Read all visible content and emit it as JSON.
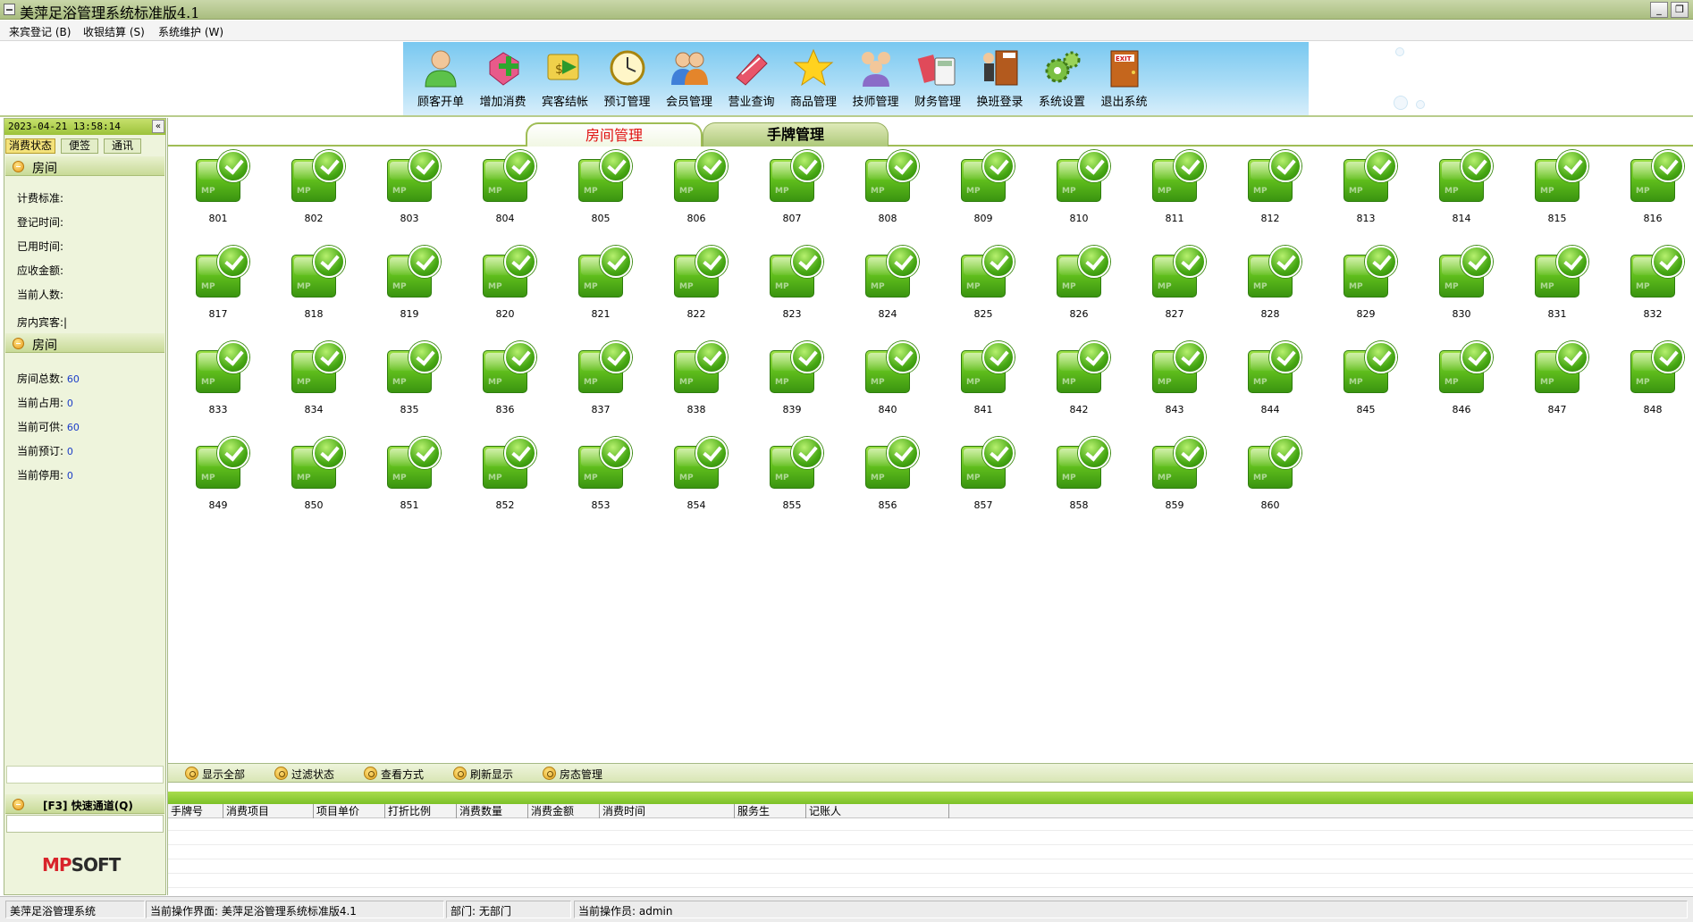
{
  "window": {
    "title": "美萍足浴管理系统标准版4.1"
  },
  "menu": [
    {
      "label": "来宾登记 (B)"
    },
    {
      "label": "收银结算 (S)"
    },
    {
      "label": "系统维护 (W)"
    }
  ],
  "toolbar": [
    {
      "label": "顾客开单",
      "icon": "customer-icon"
    },
    {
      "label": "增加消费",
      "icon": "add-consumption-icon"
    },
    {
      "label": "宾客结帐",
      "icon": "checkout-icon"
    },
    {
      "label": "预订管理",
      "icon": "clock-icon"
    },
    {
      "label": "会员管理",
      "icon": "members-icon"
    },
    {
      "label": "营业查询",
      "icon": "query-icon"
    },
    {
      "label": "商品管理",
      "icon": "star-icon"
    },
    {
      "label": "技师管理",
      "icon": "technician-icon"
    },
    {
      "label": "财务管理",
      "icon": "calculator-icon"
    },
    {
      "label": "换班登录",
      "icon": "shift-door-icon"
    },
    {
      "label": "系统设置",
      "icon": "gears-icon"
    },
    {
      "label": "退出系统",
      "icon": "exit-door-icon"
    }
  ],
  "left": {
    "datetime": "2023-04-21 13:58:14",
    "collapse": "«",
    "tabs": [
      "消费状态",
      "便签",
      "通讯"
    ],
    "section1": {
      "title": "房间",
      "fields": [
        "计费标准:",
        "登记时间:",
        "已用时间:",
        "应收金额:",
        "当前人数:",
        "房内宾客:|"
      ]
    },
    "section2": {
      "title": "房间",
      "stats": [
        {
          "label": "房间总数:",
          "value": "60"
        },
        {
          "label": "当前占用:",
          "value": "0"
        },
        {
          "label": "当前可供:",
          "value": "60"
        },
        {
          "label": "当前预订:",
          "value": "0"
        },
        {
          "label": "当前停用:",
          "value": "0"
        }
      ]
    },
    "quick": {
      "title": "[F3] 快速通道(Q)"
    },
    "logo": {
      "part1": "MP",
      "part2": "SOFT"
    }
  },
  "main": {
    "tabs": [
      {
        "label": "房间管理",
        "active": true
      },
      {
        "label": "手牌管理",
        "active": false
      }
    ],
    "rooms": [
      "801",
      "802",
      "803",
      "804",
      "805",
      "806",
      "807",
      "808",
      "809",
      "810",
      "811",
      "812",
      "813",
      "814",
      "815",
      "816",
      "817",
      "818",
      "819",
      "820",
      "821",
      "822",
      "823",
      "824",
      "825",
      "826",
      "827",
      "828",
      "829",
      "830",
      "831",
      "832",
      "833",
      "834",
      "835",
      "836",
      "837",
      "838",
      "839",
      "840",
      "841",
      "842",
      "843",
      "844",
      "845",
      "846",
      "847",
      "848",
      "849",
      "850",
      "851",
      "852",
      "853",
      "854",
      "855",
      "856",
      "857",
      "858",
      "859",
      "860"
    ],
    "room_tile_mark": "MP",
    "bottom_toolbar": [
      "显示全部",
      "过滤状态",
      "查看方式",
      "刷新显示",
      "房态管理"
    ],
    "grid_columns": [
      "手牌号",
      "消费项目",
      "项目单价",
      "打折比例",
      "消费数量",
      "消费金额",
      "消费时间",
      "服务生",
      "记账人"
    ]
  },
  "status": {
    "app": "美萍足浴管理系统",
    "screen": "当前操作界面: 美萍足浴管理系统标准版4.1",
    "dept": "部门: 无部门",
    "operator": "当前操作员: admin"
  },
  "colors": {
    "accent_green": "#7cc128",
    "toolbar_blue": "#79c8f0",
    "active_tab_text": "#e01010",
    "stat_value": "#1a3cc8"
  }
}
